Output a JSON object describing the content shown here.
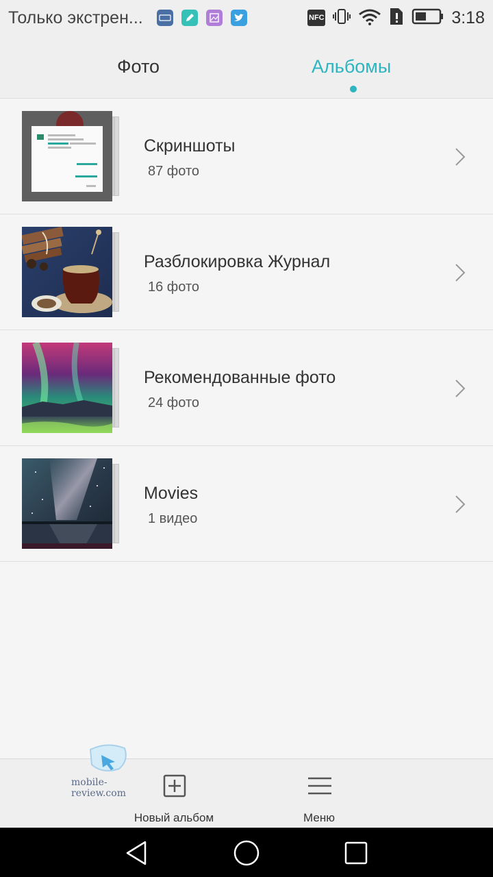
{
  "status_bar": {
    "notification_text": "Только экстрен...",
    "time": "3:18",
    "notification_icons": [
      "lovi-app-icon",
      "notes-app-icon",
      "gallery-app-icon",
      "twitter-icon"
    ],
    "nfc_label": "NFC",
    "system_icons": [
      "nfc-icon",
      "vibrate-icon",
      "wifi-icon",
      "sim-icon",
      "battery-icon"
    ]
  },
  "tabs": [
    {
      "label": "Фото",
      "active": false
    },
    {
      "label": "Альбомы",
      "active": true
    }
  ],
  "albums": [
    {
      "title": "Скриншоты",
      "count": "87 фото",
      "thumb": "screenshot"
    },
    {
      "title": "Разблокировка Журнал",
      "count": "16 фото",
      "thumb": "tea"
    },
    {
      "title": "Рекомендованные фото",
      "count": "24 фото",
      "thumb": "aurora"
    },
    {
      "title": "Movies",
      "count": "1 видео",
      "thumb": "milkyway"
    }
  ],
  "bottom_bar": {
    "new_album_label": "Новый альбом",
    "menu_label": "Меню"
  },
  "watermark": "mobile-review.com",
  "colors": {
    "accent": "#2db5c0",
    "background": "#f5f5f5",
    "bar": "#efefef"
  }
}
